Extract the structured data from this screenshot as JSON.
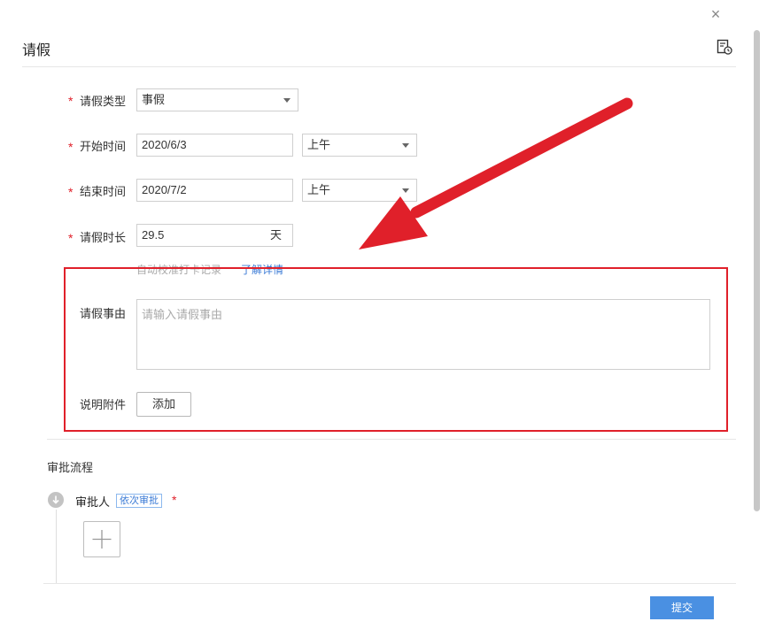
{
  "dialog": {
    "title": "请假",
    "close_glyph": "×"
  },
  "form": {
    "required_mark": "*",
    "leave_type": {
      "label": "请假类型",
      "value": "事假"
    },
    "start_time": {
      "label": "开始时间",
      "date": "2020/6/3",
      "period": "上午"
    },
    "end_time": {
      "label": "结束时间",
      "date": "2020/7/2",
      "period": "上午"
    },
    "duration": {
      "label": "请假时长",
      "value": "29.5",
      "unit": "天"
    },
    "auto_calibrate": {
      "text": "自动校准打卡记录",
      "link": "了解详情"
    },
    "reason": {
      "label": "请假事由",
      "placeholder": "请输入请假事由"
    },
    "attachment": {
      "label": "说明附件",
      "button": "添加"
    }
  },
  "approval": {
    "section_title": "审批流程",
    "approver_label": "审批人",
    "approver_tag": "依次审批",
    "required_mark": "*",
    "add_glyph": "+"
  },
  "footer": {
    "submit": "提交"
  },
  "annotation": {
    "arrow_color": "#e0202a",
    "box_color": "#e0202a"
  },
  "icons": {
    "close": "close-icon",
    "doc": "document-clock-icon",
    "dropdown": "chevron-down-icon",
    "approver_node": "arrow-down-circle-icon",
    "add": "plus-icon"
  }
}
